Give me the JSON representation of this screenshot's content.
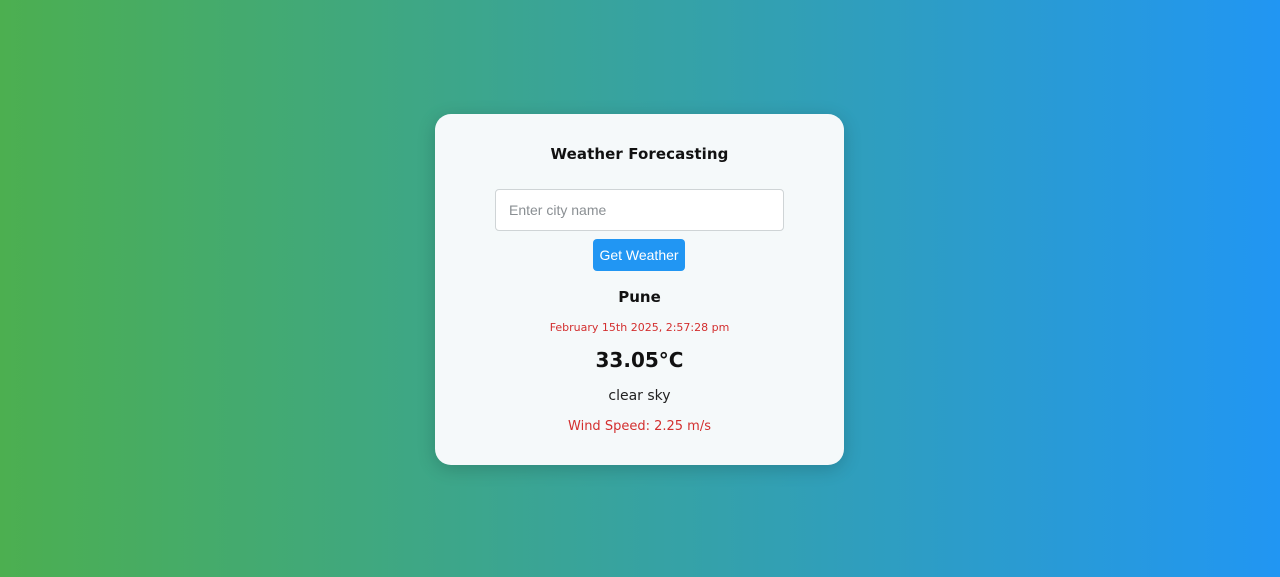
{
  "app": {
    "title": "Weather Forecasting"
  },
  "search": {
    "placeholder": "Enter city name",
    "value": "",
    "button_label": "Get Weather"
  },
  "weather": {
    "city": "Pune",
    "datetime": "February 15th 2025, 2:57:28 pm",
    "temperature": "33.05°C",
    "description": "clear sky",
    "wind": "Wind Speed: 2.25 m/s"
  },
  "colors": {
    "gradient_start": "#4caf50",
    "gradient_end": "#2196f3",
    "button": "#2196f3",
    "accent_text": "#d32f2f"
  }
}
